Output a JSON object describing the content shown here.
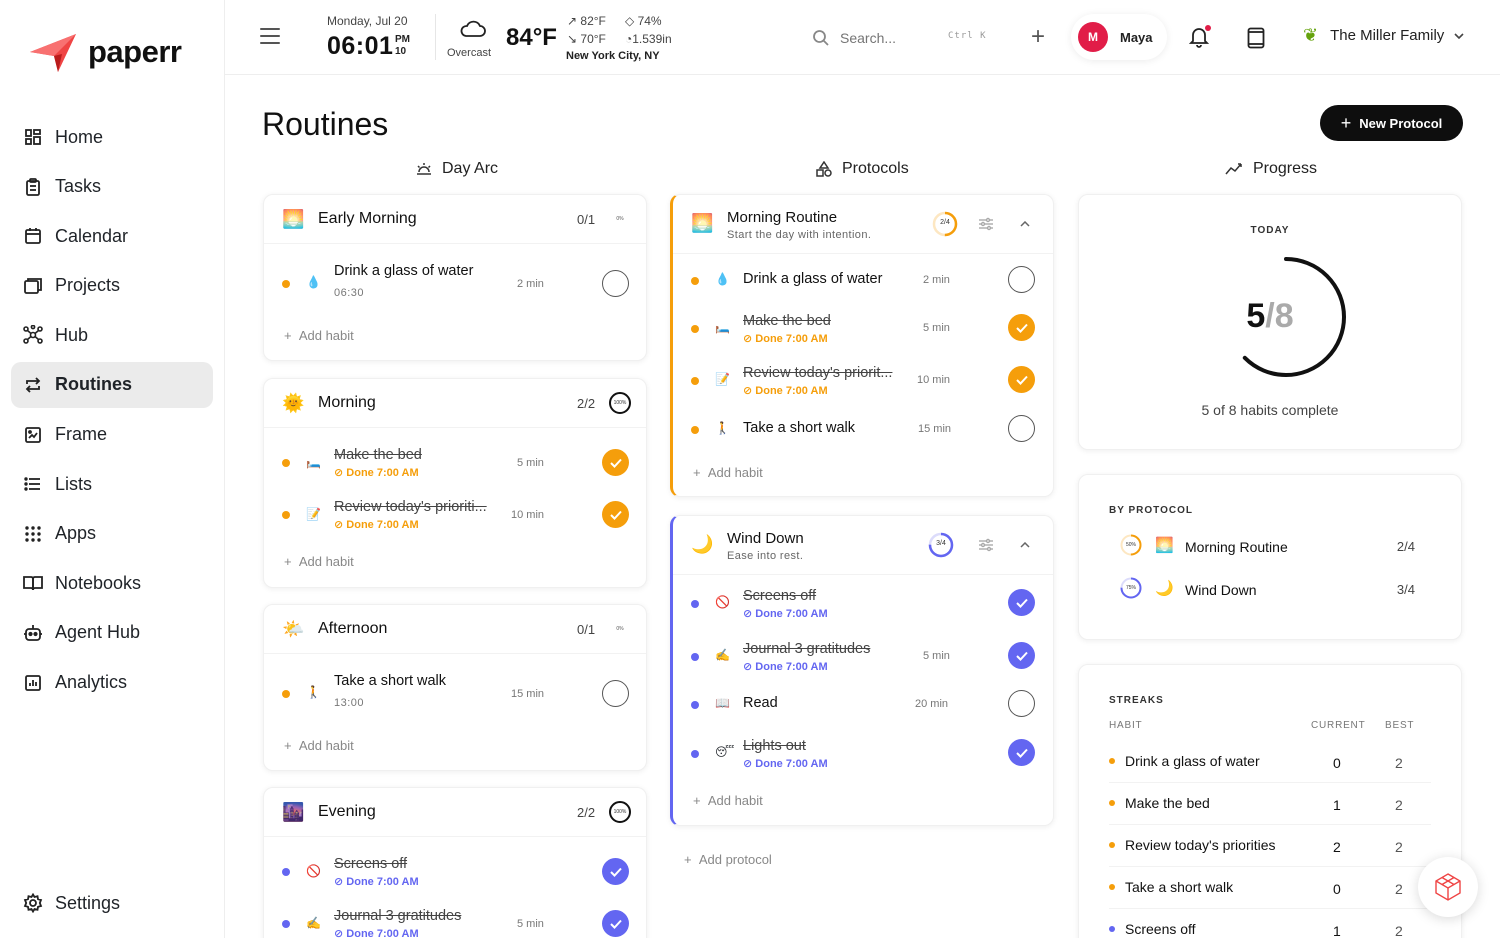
{
  "app": {
    "name": "paperr"
  },
  "sidebar": {
    "items": [
      {
        "label": "Home",
        "icon": "home-grid-icon"
      },
      {
        "label": "Tasks",
        "icon": "clipboard-icon"
      },
      {
        "label": "Calendar",
        "icon": "calendar-icon"
      },
      {
        "label": "Projects",
        "icon": "folder-icon"
      },
      {
        "label": "Hub",
        "icon": "hub-icon"
      },
      {
        "label": "Routines",
        "icon": "repeat-icon",
        "active": true
      },
      {
        "label": "Frame",
        "icon": "frame-icon"
      },
      {
        "label": "Lists",
        "icon": "list-icon"
      },
      {
        "label": "Apps",
        "icon": "apps-icon"
      },
      {
        "label": "Notebooks",
        "icon": "book-icon"
      },
      {
        "label": "Agent Hub",
        "icon": "robot-icon"
      },
      {
        "label": "Analytics",
        "icon": "chart-icon"
      }
    ],
    "settings_label": "Settings"
  },
  "header": {
    "date": "Monday, Jul 20",
    "time": "06:01",
    "ampm": "PM",
    "seconds": "10",
    "weather": {
      "condition": "Overcast",
      "temp": "84°F",
      "high": "82°F",
      "low": "70°F",
      "humidity": "74%",
      "pressure": "1.539in",
      "location": "New York City, NY"
    },
    "search_placeholder": "Search...",
    "search_shortcut": "Ctrl K",
    "user": {
      "initial": "M",
      "name": "Maya"
    },
    "family": "The Miller Family"
  },
  "page": {
    "title": "Routines",
    "new_protocol_label": "New Protocol",
    "columns": {
      "day_arc": "Day Arc",
      "protocols": "Protocols",
      "progress": "Progress"
    },
    "add_habit_label": "Add habit",
    "add_protocol_label": "Add protocol"
  },
  "colors": {
    "orange": "#f59e0b",
    "indigo": "#6366f1",
    "red": "#e11d48"
  },
  "day_arc": {
    "early_morning": {
      "title": "Early Morning",
      "count": "0/1",
      "pct": "0%",
      "habits": [
        {
          "name": "Drink a glass of water",
          "sub": "06:30",
          "min": "2 min"
        }
      ]
    },
    "morning": {
      "title": "Morning",
      "count": "2/2",
      "pct": "100%",
      "habits": [
        {
          "name": "Make the bed",
          "done": "Done 7:00 AM",
          "min": "5 min"
        },
        {
          "name": "Review today's prioriti...",
          "done": "Done 7:00 AM",
          "min": "10 min"
        }
      ]
    },
    "afternoon": {
      "title": "Afternoon",
      "count": "0/1",
      "pct": "0%",
      "habits": [
        {
          "name": "Take a short walk",
          "sub": "13:00",
          "min": "15 min"
        }
      ]
    },
    "evening": {
      "title": "Evening",
      "count": "2/2",
      "pct": "100%",
      "habits": [
        {
          "name": "Screens off",
          "done": "Done 7:00 AM"
        },
        {
          "name": "Journal 3 gratitudes",
          "done": "Done 7:00 AM",
          "min": "5 min"
        }
      ]
    }
  },
  "protocols": {
    "morning": {
      "title": "Morning Routine",
      "subtitle": "Start the day with intention.",
      "ring": "2/4",
      "habits": [
        {
          "name": "Drink a glass of water",
          "min": "2 min"
        },
        {
          "name": "Make the bed",
          "done": "Done 7:00 AM",
          "min": "5 min"
        },
        {
          "name": "Review today's priorit...",
          "done": "Done 7:00 AM",
          "min": "10 min"
        },
        {
          "name": "Take a short walk",
          "min": "15 min"
        }
      ]
    },
    "wind_down": {
      "title": "Wind Down",
      "subtitle": "Ease into rest.",
      "ring": "3/4",
      "habits": [
        {
          "name": "Screens off",
          "done": "Done 7:00 AM"
        },
        {
          "name": "Journal 3 gratitudes",
          "done": "Done 7:00 AM",
          "min": "5 min"
        },
        {
          "name": "Read",
          "min": "20 min"
        },
        {
          "name": "Lights out",
          "done": "Done 7:00 AM"
        }
      ]
    }
  },
  "progress": {
    "today_label": "TODAY",
    "done": "5",
    "total": "8",
    "fraction": 0.625,
    "complete_label": "5 of 8 habits complete",
    "by_protocol_label": "BY PROTOCOL",
    "by_protocol": [
      {
        "pct": "50%",
        "name": "Morning Routine",
        "count": "2/4"
      },
      {
        "pct": "75%",
        "name": "Wind Down",
        "count": "3/4"
      }
    ],
    "streaks_label": "STREAKS",
    "streak_cols": {
      "habit": "HABIT",
      "current": "CURRENT",
      "best": "BEST"
    },
    "streaks": [
      {
        "name": "Drink a glass of water",
        "current": "0",
        "best": "2"
      },
      {
        "name": "Make the bed",
        "current": "1",
        "best": "2"
      },
      {
        "name": "Review today's priorities",
        "current": "2",
        "best": "2"
      },
      {
        "name": "Take a short walk",
        "current": "0",
        "best": "2"
      },
      {
        "name": "Screens off",
        "current": "1",
        "best": "2"
      }
    ]
  }
}
